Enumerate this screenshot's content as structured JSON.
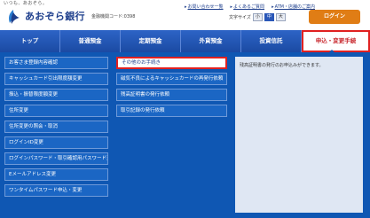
{
  "header": {
    "tagline": "いつも、あおぞら。",
    "bank_name": "あおぞら銀行",
    "bank_code": "金融機関コード:0398",
    "links": [
      {
        "label": "お問い合わせ一覧"
      },
      {
        "label": "よくあるご質問"
      },
      {
        "label": "ATM・店舗のご案内"
      }
    ],
    "font_size": {
      "label": "文字サイズ",
      "options": [
        "小",
        "中",
        "大"
      ],
      "selected": "中"
    },
    "login_label": "ログイン"
  },
  "nav": {
    "tabs": [
      {
        "label": "トップ"
      },
      {
        "label": "普通預金"
      },
      {
        "label": "定期預金"
      },
      {
        "label": "外貨預金"
      },
      {
        "label": "投資信託"
      },
      {
        "label": "申込・変更手続"
      }
    ],
    "active": "申込・変更手続"
  },
  "menu": {
    "col1": [
      "お客さま登録内容確認",
      "キャッシュカード引出限度額変更",
      "振込・振替限度額変更",
      "住所変更",
      "住所変更の照会・取消",
      "ログインID変更",
      "ログインパスワード・取引確認用パスワード変更",
      "Eメールアドレス変更",
      "ワンタイムパスワード申込・変更"
    ],
    "col2": [
      "その他のお手続き",
      "磁気不良によるキャッシュカードの再発行依頼",
      "残高証明書の発行依頼",
      "取引記録の発行依頼"
    ],
    "highlighted": "その他のお手続き",
    "description": "残高証明書の発行のお申込みができます。"
  },
  "colors": {
    "brand": "#1d3e8c",
    "nav": "#1b4aa3",
    "menu_bg": "#0f57b3",
    "login": "#e07d15",
    "highlight_border": "#e02020"
  }
}
